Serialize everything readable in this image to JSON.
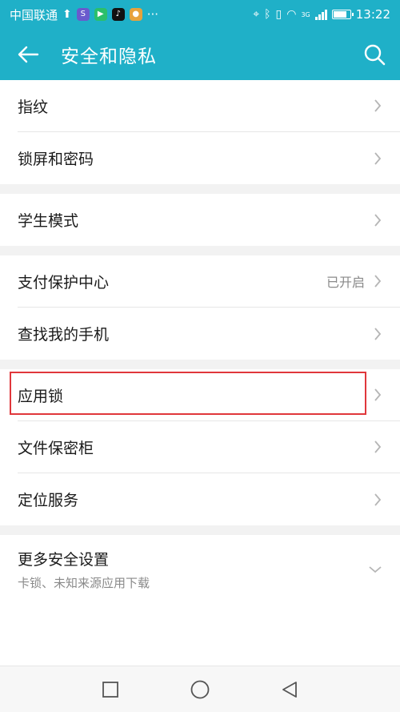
{
  "status_bar": {
    "carrier": "中国联通",
    "time": "13:22",
    "network": "3G",
    "more": "···",
    "battery_level": 0.85
  },
  "colors": {
    "accent": "#1fb0c8",
    "highlight_box": "#e0373b"
  },
  "app_bar": {
    "title": "安全和隐私",
    "back_icon": "arrow-left-icon",
    "search_icon": "search-icon"
  },
  "groups": [
    {
      "items": [
        {
          "label": "指纹"
        },
        {
          "label": "锁屏和密码"
        }
      ]
    },
    {
      "items": [
        {
          "label": "学生模式"
        }
      ]
    },
    {
      "items": [
        {
          "label": "支付保护中心",
          "value": "已开启"
        },
        {
          "label": "查找我的手机"
        }
      ]
    },
    {
      "items": [
        {
          "label": "应用锁"
        },
        {
          "label": "文件保密柜"
        },
        {
          "label": "定位服务"
        }
      ]
    },
    {
      "items": [
        {
          "label": "更多安全设置",
          "subtitle": "卡锁、未知来源应用下载"
        }
      ]
    }
  ],
  "nav_bar": {
    "icons": [
      "square-recents-icon",
      "circle-home-icon",
      "triangle-back-icon"
    ]
  }
}
